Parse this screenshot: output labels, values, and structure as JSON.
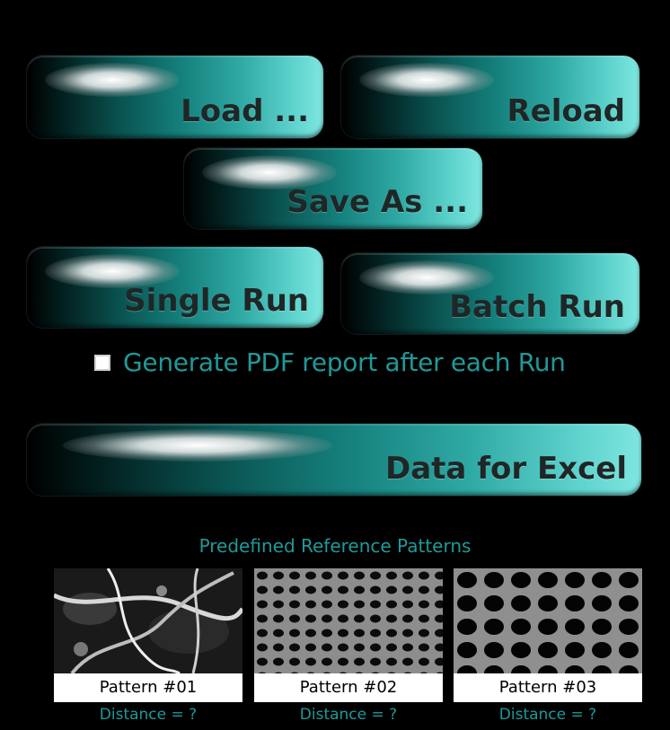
{
  "buttons": {
    "load": "Load ...",
    "reload": "Reload",
    "save_as": "Save As ...",
    "single_run": "Single Run",
    "batch_run": "Batch Run",
    "data_excel": "Data for Excel"
  },
  "pdf_option": {
    "label": "Generate PDF report after each Run",
    "checked": false
  },
  "patterns": {
    "title": "Predefined Reference Patterns",
    "items": [
      {
        "name": "Pattern #01",
        "distance": "Distance = ?"
      },
      {
        "name": "Pattern #02",
        "distance": "Distance = ?"
      },
      {
        "name": "Pattern #03",
        "distance": "Distance = ?"
      }
    ]
  },
  "colors": {
    "background": "#000000",
    "accent_teal": "#1f9a98",
    "button_highlight": "#7fe6e0"
  }
}
